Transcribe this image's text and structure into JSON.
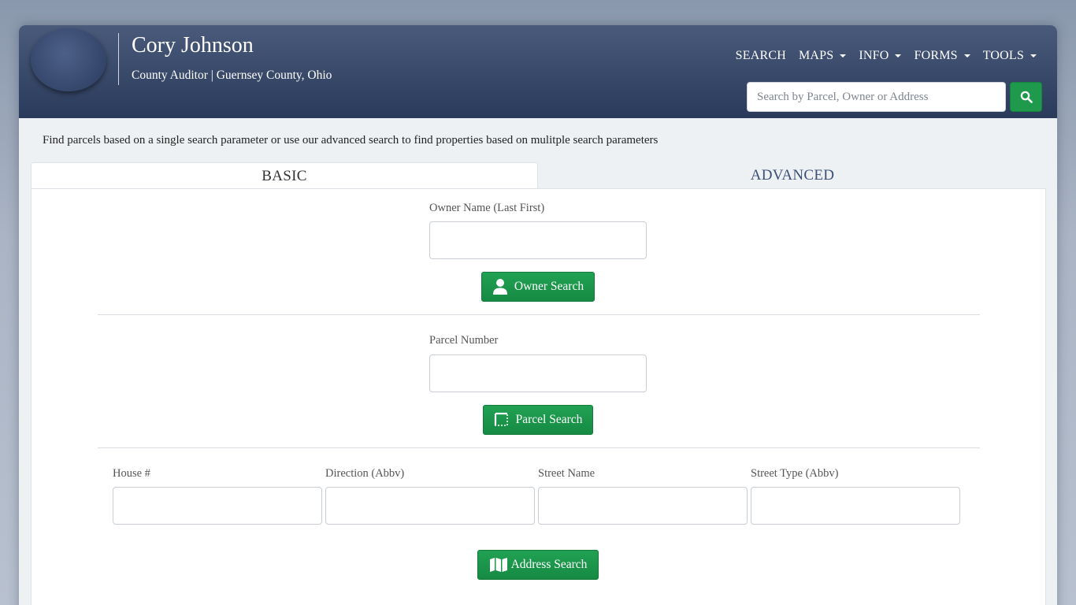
{
  "header": {
    "title": "Cory Johnson",
    "subtitle": "County Auditor | Guernsey County, Ohio",
    "nav": [
      {
        "label": "SEARCH",
        "dropdown": false
      },
      {
        "label": "MAPS",
        "dropdown": true
      },
      {
        "label": "INFO",
        "dropdown": true
      },
      {
        "label": "FORMS",
        "dropdown": true
      },
      {
        "label": "TOOLS",
        "dropdown": true
      }
    ],
    "search": {
      "placeholder": "Search by Parcel, Owner or Address",
      "value": "",
      "button_icon": "search-icon"
    }
  },
  "intro": "Find parcels based on a single search parameter or use our advanced search to find properties based on mulitple search parameters",
  "tabs": {
    "basic": "BASIC",
    "advanced": "ADVANCED",
    "active": "basic"
  },
  "owner": {
    "label": "Owner Name (Last First)",
    "value": "",
    "button": "Owner Search",
    "button_icon": "user-icon"
  },
  "parcel": {
    "label": "Parcel Number",
    "value": "",
    "button": "Parcel Search",
    "button_icon": "parcel-select-icon"
  },
  "address": {
    "house_label": "House #",
    "direction_label": "Direction (Abbv)",
    "street_name_label": "Street Name",
    "street_type_label": "Street Type (Abbv)",
    "button": "Address Search",
    "button_icon": "map-icon"
  },
  "colors": {
    "header_top": "#4a5a7a",
    "header_bottom": "#2a3a5a",
    "accent_green": "#1f9a4c",
    "tab_link": "#3b4f74"
  }
}
